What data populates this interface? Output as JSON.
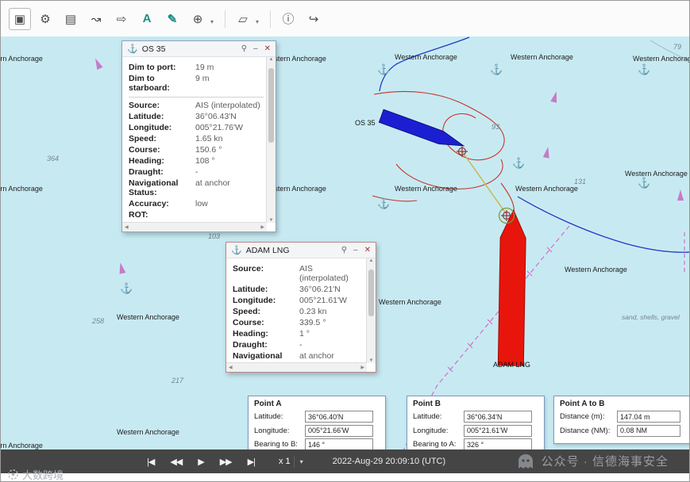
{
  "toolbar": {
    "caret": "▾",
    "items": [
      {
        "name": "select-tool",
        "glyph": "▣"
      },
      {
        "name": "settings",
        "glyph": "⚙"
      },
      {
        "name": "layers",
        "glyph": "▤"
      },
      {
        "name": "tracks-tool",
        "glyph": "↝"
      },
      {
        "name": "label-tool",
        "glyph": "⇨"
      },
      {
        "name": "text-tool",
        "glyph": "A"
      },
      {
        "name": "measure-tool",
        "glyph": "✎"
      },
      {
        "name": "projection",
        "glyph": "⊕"
      },
      {
        "name": "draw-shape",
        "glyph": "▱"
      },
      {
        "name": "info",
        "glyph": "ⓘ"
      },
      {
        "name": "exit",
        "glyph": "↪"
      }
    ]
  },
  "map": {
    "anchorage_label": "Western Anchorage",
    "anchor_glyph": "⚓",
    "seabed_label": "sand, shells, gravel",
    "os35_label": "OS 35",
    "adam_label": "ADAM LNG",
    "soundings": [
      "364",
      "258",
      "217",
      "103",
      "93",
      "131",
      "79"
    ]
  },
  "popup_os35": {
    "title": "OS 35",
    "anchor_icon": "⚓",
    "pin_icon": "⚲",
    "min_icon": "–",
    "close_icon": "✕",
    "rows": [
      {
        "label": "Dim to port:",
        "value": "19 m"
      },
      {
        "label": "Dim to starboard:",
        "value": "9 m"
      },
      {
        "label": "Source:",
        "value": "AIS (interpolated)"
      },
      {
        "label": "Latitude:",
        "value": "36°06.43'N"
      },
      {
        "label": "Longitude:",
        "value": "005°21.76'W"
      },
      {
        "label": "Speed:",
        "value": "1.65 kn"
      },
      {
        "label": "Course:",
        "value": "150.6 °"
      },
      {
        "label": "Heading:",
        "value": "108 °"
      },
      {
        "label": "Draught:",
        "value": "-"
      },
      {
        "label": "Navigational Status:",
        "value": "at anchor"
      },
      {
        "label": "Accuracy:",
        "value": "low"
      },
      {
        "label": "ROT:",
        "value": ""
      }
    ]
  },
  "popup_adam": {
    "title": "ADAM LNG",
    "anchor_icon": "⚓",
    "pin_icon": "⚲",
    "min_icon": "–",
    "close_icon": "✕",
    "rows": [
      {
        "label": "Source:",
        "value": "AIS (interpolated)"
      },
      {
        "label": "Latitude:",
        "value": "36°06.21'N"
      },
      {
        "label": "Longitude:",
        "value": "005°21.61'W"
      },
      {
        "label": "Speed:",
        "value": "0.23 kn"
      },
      {
        "label": "Course:",
        "value": "339.5 °"
      },
      {
        "label": "Heading:",
        "value": "1 °"
      },
      {
        "label": "Draught:",
        "value": "-"
      },
      {
        "label": "Navigational Status:",
        "value": "at anchor"
      }
    ]
  },
  "panels": {
    "a": {
      "title": "Point A",
      "rows": [
        {
          "label": "Latitude:",
          "value": "36°06.40'N"
        },
        {
          "label": "Longitude:",
          "value": "005°21.66'W"
        },
        {
          "label": "Bearing to B:",
          "value": "146 °"
        }
      ]
    },
    "b": {
      "title": "Point B",
      "rows": [
        {
          "label": "Latitude:",
          "value": "36°06.34'N"
        },
        {
          "label": "Longitude:",
          "value": "005°21.61'W"
        },
        {
          "label": "Bearing to A:",
          "value": "326 °"
        }
      ]
    },
    "ab": {
      "title": "Point A to B",
      "rows": [
        {
          "label": "Distance (m):",
          "value": "147.04 m"
        },
        {
          "label": "Distance (NM):",
          "value": "0.08 NM"
        }
      ]
    }
  },
  "playback": {
    "buttons": [
      {
        "name": "skip-to-start",
        "glyph": "|◀"
      },
      {
        "name": "step-back",
        "glyph": "◀◀"
      },
      {
        "name": "play",
        "glyph": "▶"
      },
      {
        "name": "step-forward",
        "glyph": "▶▶"
      },
      {
        "name": "skip-to-end",
        "glyph": "▶|"
      }
    ],
    "speed": "x 1",
    "timestamp": "2022-Aug-29 20:09:10 (UTC)"
  },
  "watermarks": {
    "playbar": "公众号 · 信德海事安全",
    "bottom_left": "大数跨境"
  },
  "colors": {
    "os35_hull": "#1c1fd1",
    "adam_hull": "#e8150c",
    "track_red": "#c8322c",
    "track_blue": "#2438c8",
    "boundary_magenta": "#cf6fcf",
    "accent_teal": "#1d8f86"
  }
}
